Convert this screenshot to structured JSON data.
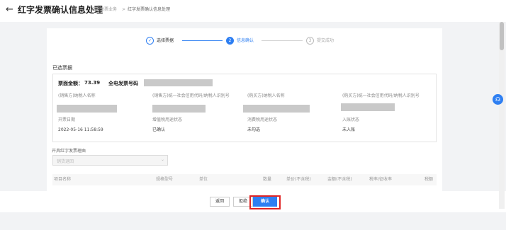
{
  "header": {
    "back_icon": "←",
    "title": "红字发票确认信息处理",
    "breadcrumb_1": "红字发票业务",
    "breadcrumb_sep": ">",
    "breadcrumb_2": "红字发票确认信息处理"
  },
  "steps": [
    {
      "label": "选择票据",
      "icon": "✓",
      "state": "done"
    },
    {
      "label": "信息确认",
      "icon": "2",
      "state": "active"
    },
    {
      "label": "提交成功",
      "icon": "3",
      "state": "pending"
    }
  ],
  "section": {
    "title": "已选票据"
  },
  "invoice": {
    "amount_label": "票面金额：",
    "amount_value": "73.39",
    "code_label": "全电发票号码",
    "seller_name_label": "(销售方)纳税人名称",
    "seller_id_label": "(销售方)统一社会信用代码/纳税人识别号",
    "buyer_name_label": "(购买方)纳税人名称",
    "buyer_id_label": "(购买方)统一社会信用代码/纳税人识别号",
    "issue_date_label": "开票日期",
    "issue_date_value": "2022-05-16 11:58:59",
    "vat_status_label": "增值税用途状态",
    "vat_status_value": "已确认",
    "consumption_status_label": "消费税用途状态",
    "consumption_status_value": "未勾选",
    "account_status_label": "入账状态",
    "account_status_value": "未入账"
  },
  "reason": {
    "label": "开具红字发票理由",
    "placeholder": "销货退回",
    "arrow": "⌄"
  },
  "table": {
    "headers": [
      "项目名称",
      "规格型号",
      "单位",
      "数量",
      "单价(不含税)",
      "金额(不含税)",
      "税率/征收率",
      "税额"
    ]
  },
  "footer": {
    "back_label": "返回",
    "reject_label": "拒绝",
    "confirm_label": "确认"
  },
  "float_button": {
    "icon": "headset-icon",
    "glyph": "☊"
  },
  "colors": {
    "accent": "#2e7ff2",
    "highlight": "#e02424",
    "success": "#2e7ff2"
  }
}
